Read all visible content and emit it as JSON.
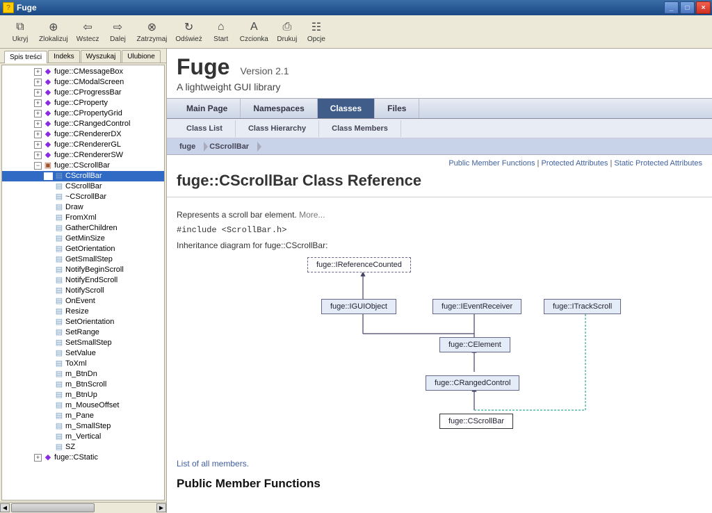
{
  "window": {
    "title": "Fuge"
  },
  "toolbar": [
    {
      "icon": "⧉",
      "label": "Ukryj"
    },
    {
      "icon": "⊕",
      "label": "Zlokalizuj"
    },
    {
      "icon": "⇦",
      "label": "Wstecz"
    },
    {
      "icon": "⇨",
      "label": "Dalej"
    },
    {
      "icon": "⊗",
      "label": "Zatrzymaj"
    },
    {
      "icon": "↻",
      "label": "Odśwież"
    },
    {
      "icon": "⌂",
      "label": "Start"
    },
    {
      "icon": "A",
      "label": "Czcionka"
    },
    {
      "icon": "⎙",
      "label": "Drukuj"
    },
    {
      "icon": "☷",
      "label": "Opcje"
    }
  ],
  "side_tabs": [
    "Spis treści",
    "Indeks",
    "Wyszukaj",
    "Ulubione"
  ],
  "tree_collapsed": [
    "fuge::CMessageBox",
    "fuge::CModalScreen",
    "fuge::CProgressBar",
    "fuge::CProperty",
    "fuge::CPropertyGrid",
    "fuge::CRangedControl",
    "fuge::CRendererDX",
    "fuge::CRendererGL",
    "fuge::CRendererSW"
  ],
  "tree_open": "fuge::CScrollBar",
  "tree_children": [
    "CScrollBar",
    "CScrollBar",
    "~CScrollBar",
    "Draw",
    "FromXml",
    "GatherChildren",
    "GetMinSize",
    "GetOrientation",
    "GetSmallStep",
    "NotifyBeginScroll",
    "NotifyEndScroll",
    "NotifyScroll",
    "OnEvent",
    "Resize",
    "SetOrientation",
    "SetRange",
    "SetSmallStep",
    "SetValue",
    "ToXml",
    "m_BtnDn",
    "m_BtnScroll",
    "m_BtnUp",
    "m_MouseOffset",
    "m_Pane",
    "m_SmallStep",
    "m_Vertical",
    "SZ"
  ],
  "tree_after": "fuge::CStatic",
  "doc": {
    "title": "Fuge",
    "version": "Version 2.1",
    "subtitle": "A lightweight GUI library"
  },
  "nav_tabs": [
    {
      "label": "Main Page",
      "active": false
    },
    {
      "label": "Namespaces",
      "active": false
    },
    {
      "label": "Classes",
      "active": true
    },
    {
      "label": "Files",
      "active": false
    }
  ],
  "subnav": [
    "Class List",
    "Class Hierarchy",
    "Class Members"
  ],
  "breadcrumb": [
    "fuge",
    "CScrollBar"
  ],
  "right_links": [
    "Public Member Functions",
    "Protected Attributes",
    "Static Protected Attributes"
  ],
  "page_title": "fuge::CScrollBar Class Reference",
  "description": "Represents a scroll bar element.",
  "more": "More...",
  "include": "#include <ScrollBar.h>",
  "inheritance_label": "Inheritance diagram for fuge::CScrollBar:",
  "diagram_nodes": {
    "ref": "fuge::IReferenceCounted",
    "gui": "fuge::IGUIObject",
    "evt": "fuge::IEventReceiver",
    "trk": "fuge::ITrackScroll",
    "elem": "fuge::CElement",
    "rng": "fuge::CRangedControl",
    "sb": "fuge::CScrollBar"
  },
  "list_link": "List of all members.",
  "section_title": "Public Member Functions"
}
